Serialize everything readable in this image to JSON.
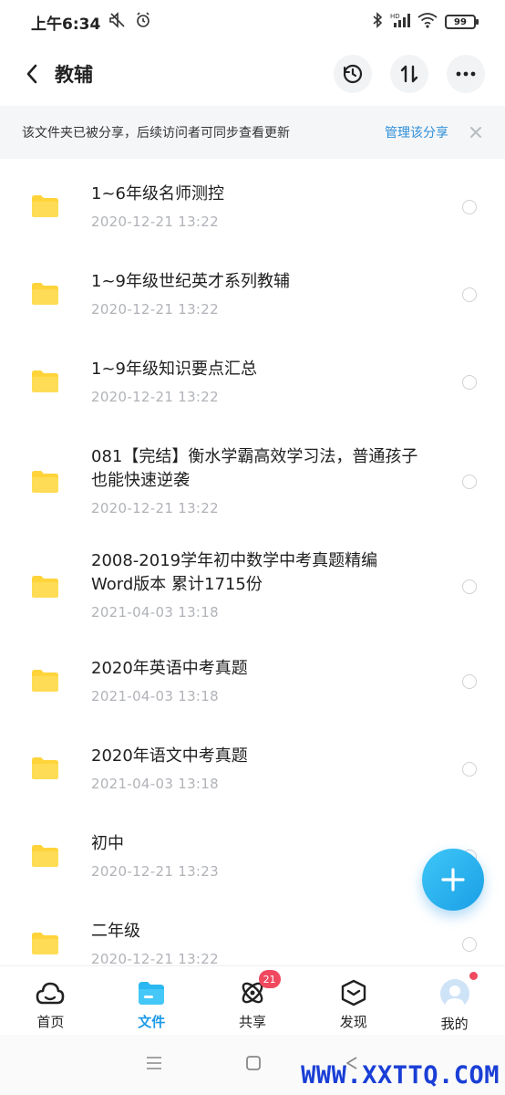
{
  "status_bar": {
    "time": "上午6:34",
    "icons": [
      "mute-icon",
      "alarm-icon",
      "bluetooth-icon",
      "hd-signal-icon",
      "wifi-icon"
    ],
    "battery": "99"
  },
  "header": {
    "title": "教辅",
    "actions": [
      "history-icon",
      "sort-icon",
      "more-icon"
    ]
  },
  "banner": {
    "text": "该文件夹已被分享，后续访问者可同步查看更新",
    "link": "管理该分享"
  },
  "files": [
    {
      "name": "1~6年级名师测控",
      "date": "2020-12-21  13:22"
    },
    {
      "name": "1~9年级世纪英才系列教辅",
      "date": "2020-12-21  13:22"
    },
    {
      "name": "1~9年级知识要点汇总",
      "date": "2020-12-21  13:22"
    },
    {
      "name": "081【完结】衡水学霸高效学习法，普通孩子也能快速逆袭",
      "date": "2020-12-21  13:22"
    },
    {
      "name": "2008-2019学年初中数学中考真题精编Word版本  累计1715份",
      "date": "2021-04-03  13:18"
    },
    {
      "name": "2020年英语中考真题",
      "date": "2021-04-03  13:18"
    },
    {
      "name": "2020年语文中考真题",
      "date": "2021-04-03  13:18"
    },
    {
      "name": "初中",
      "date": "2020-12-21  13:23"
    },
    {
      "name": "二年级",
      "date": "2020-12-21  13:22"
    }
  ],
  "bottom_nav": [
    {
      "label": "首页",
      "icon": "cloud-home-icon"
    },
    {
      "label": "文件",
      "icon": "folder-icon",
      "active": true
    },
    {
      "label": "共享",
      "icon": "share-atom-icon",
      "badge": "21"
    },
    {
      "label": "发现",
      "icon": "discover-box-icon"
    },
    {
      "label": "我的",
      "icon": "avatar-icon",
      "dot": true
    }
  ],
  "watermark": "WWW.XXTTQ.COM",
  "colors": {
    "accent": "#1c9ae8",
    "folder": "#ffd43b",
    "badge": "#f0485f"
  }
}
